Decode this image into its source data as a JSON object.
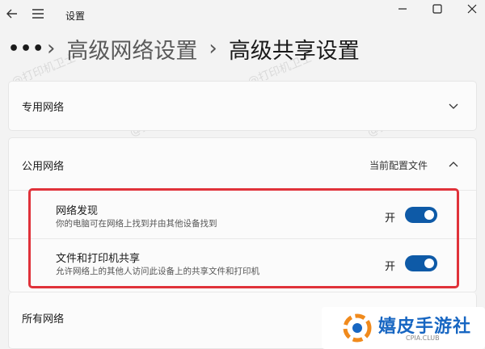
{
  "titlebar": {
    "title": "设置",
    "back_icon": "back-arrow-icon",
    "menu_icon": "hamburger-menu-icon"
  },
  "breadcrumb": {
    "more": "•••",
    "separator": "›",
    "parent": "高级网络设置",
    "current": "高级共享设置"
  },
  "sections": {
    "private": {
      "label": "专用网络"
    },
    "public": {
      "label": "公用网络",
      "current_profile": "当前配置文件",
      "items": [
        {
          "title": "网络发现",
          "description": "你的电脑可在网络上找到并由其他设备找到",
          "state_label": "开",
          "on": true
        },
        {
          "title": "文件和打印机共享",
          "description": "允许网络上的其他人访问此设备上的共享文件和打印机",
          "state_label": "开",
          "on": true
        }
      ]
    },
    "all": {
      "label": "所有网络"
    }
  },
  "watermark": "@打印机卫士",
  "logo": {
    "text": "嬉皮手游社",
    "subtext": "CPIA.CLUB"
  },
  "colors": {
    "toggle_on": "#0e5aa7",
    "highlight": "#e0323a",
    "logo_blue": "#1766c2",
    "logo_orange": "#f08a1c"
  }
}
